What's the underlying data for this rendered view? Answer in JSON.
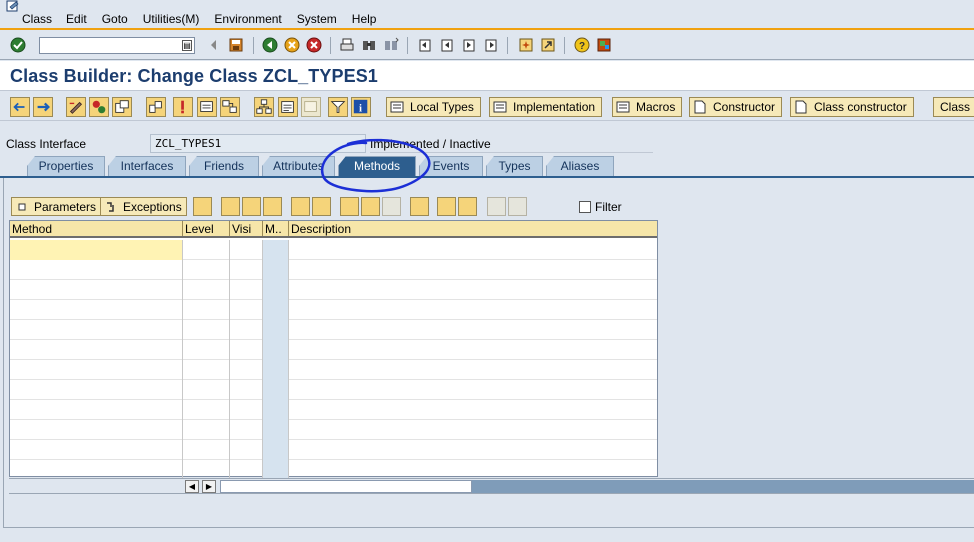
{
  "menu": {
    "items": [
      "Class",
      "Edit",
      "Goto",
      "Utilities(M)",
      "Environment",
      "System",
      "Help"
    ]
  },
  "standard_toolbar": {
    "command_field_value": "",
    "icons": [
      "enter-icon",
      "save-icon",
      "back-icon",
      "exit-icon",
      "cancel-icon",
      "print-icon",
      "find-icon",
      "find-next-icon",
      "first-page-icon",
      "previous-page-icon",
      "next-page-icon",
      "last-page-icon",
      "create-session-icon",
      "shortcut-icon",
      "help-icon",
      "customize-layout-icon"
    ]
  },
  "title": "Class Builder: Change Class ZCL_TYPES1",
  "app_toolbar": {
    "icons": [
      "previous-object-icon",
      "next-object-icon",
      "display-change-icon",
      "active-inactive-icon",
      "other-object-icon",
      "check-icon",
      "activate-icon",
      "where-used-icon",
      "display-object-list-icon",
      "object-hierarchy-icon",
      "class-documentation-icon",
      "inactive-area-icon",
      "filter-icon",
      "info-icon"
    ],
    "buttons": [
      "Local Types",
      "Implementation",
      "Macros",
      "Constructor",
      "Class constructor",
      "Class"
    ]
  },
  "class_interface": {
    "label": "Class Interface",
    "value": "ZCL_TYPES1",
    "status": "Implemented / Inactive"
  },
  "tabs": [
    {
      "label": "Properties",
      "active": false
    },
    {
      "label": "Interfaces",
      "active": false
    },
    {
      "label": "Friends",
      "active": false
    },
    {
      "label": "Attributes",
      "active": false
    },
    {
      "label": "Methods",
      "active": true
    },
    {
      "label": "Events",
      "active": false
    },
    {
      "label": "Types",
      "active": false
    },
    {
      "label": "Aliases",
      "active": false
    }
  ],
  "methods_toolbar": {
    "parameters_label": "Parameters",
    "exceptions_label": "Exceptions",
    "filter_label": "Filter",
    "filter_checked": false
  },
  "grid": {
    "columns": [
      "Method",
      "Level",
      "Visi",
      "M..",
      "Description"
    ],
    "rows": [
      {
        "method": "",
        "level": "",
        "visi": "",
        "m": "",
        "description": ""
      },
      {
        "method": "",
        "level": "",
        "visi": "",
        "m": "",
        "description": ""
      },
      {
        "method": "",
        "level": "",
        "visi": "",
        "m": "",
        "description": ""
      },
      {
        "method": "",
        "level": "",
        "visi": "",
        "m": "",
        "description": ""
      },
      {
        "method": "",
        "level": "",
        "visi": "",
        "m": "",
        "description": ""
      },
      {
        "method": "",
        "level": "",
        "visi": "",
        "m": "",
        "description": ""
      },
      {
        "method": "",
        "level": "",
        "visi": "",
        "m": "",
        "description": ""
      },
      {
        "method": "",
        "level": "",
        "visi": "",
        "m": "",
        "description": ""
      },
      {
        "method": "",
        "level": "",
        "visi": "",
        "m": "",
        "description": ""
      },
      {
        "method": "",
        "level": "",
        "visi": "",
        "m": "",
        "description": ""
      },
      {
        "method": "",
        "level": "",
        "visi": "",
        "m": "",
        "description": ""
      },
      {
        "method": "",
        "level": "",
        "visi": "",
        "m": "",
        "description": ""
      }
    ]
  },
  "colors": {
    "title": "#1c3d6e",
    "active_tab": "#2d5e8e",
    "annotation_circle": "#1c2fd6",
    "accent_line": "#f0a10f"
  }
}
